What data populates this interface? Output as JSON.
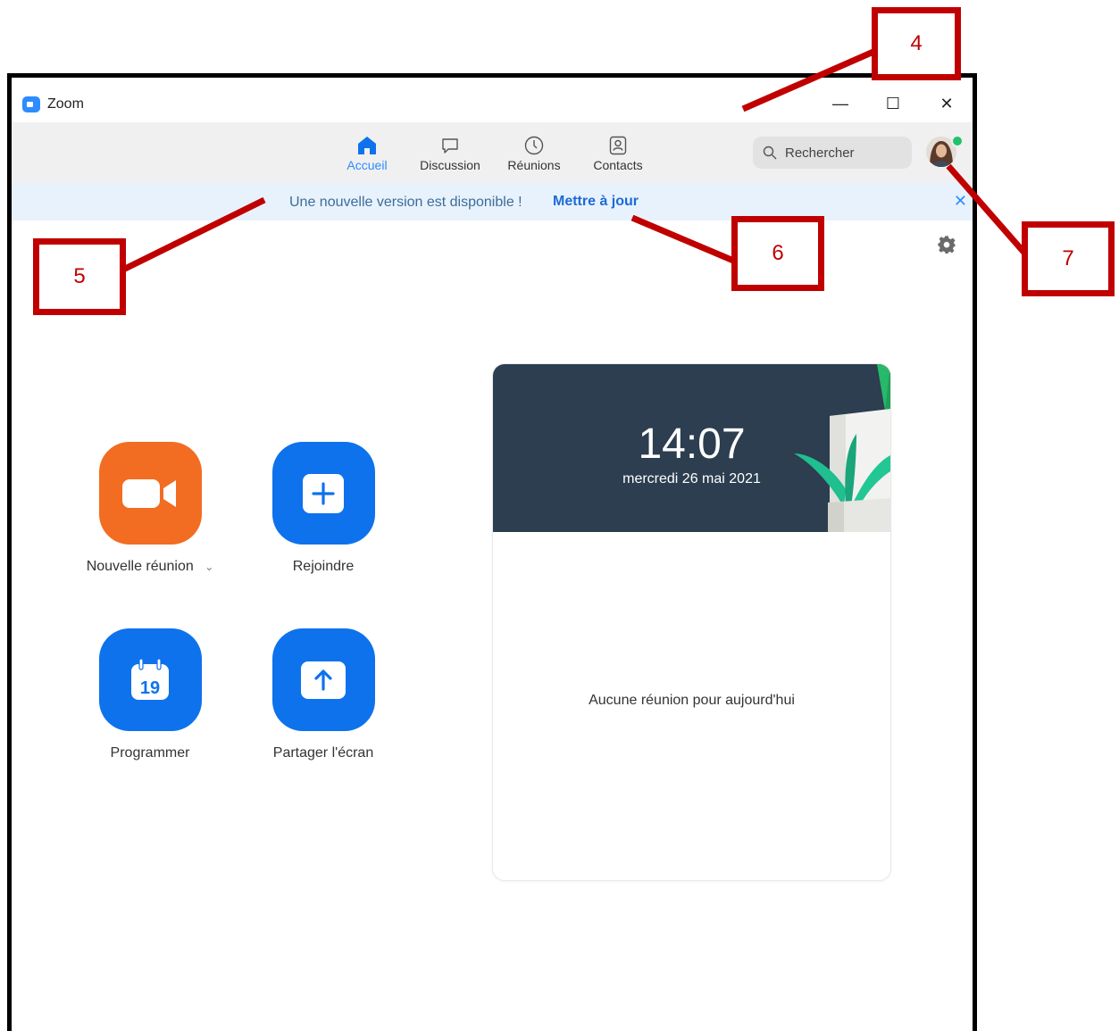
{
  "window": {
    "app_title": "Zoom",
    "controls": {
      "minimize": "—",
      "maximize": "☐",
      "close": "✕"
    }
  },
  "nav": {
    "tabs": [
      {
        "label": "Accueil",
        "icon": "home-icon",
        "active": true
      },
      {
        "label": "Discussion",
        "icon": "chat-icon",
        "active": false
      },
      {
        "label": "Réunions",
        "icon": "clock-icon",
        "active": false
      },
      {
        "label": "Contacts",
        "icon": "contacts-icon",
        "active": false
      }
    ],
    "search_placeholder": "Rechercher",
    "presence_status": "available"
  },
  "banner": {
    "message": "Une nouvelle version est disponible !",
    "action": "Mettre à jour",
    "close": "✕"
  },
  "actions": [
    {
      "label": "Nouvelle réunion",
      "icon": "video-camera-icon",
      "color": "#f26d21",
      "dropdown": "⌄"
    },
    {
      "label": "Rejoindre",
      "icon": "plus-icon",
      "color": "#0e72ed"
    },
    {
      "label": "Programmer",
      "icon": "calendar-icon",
      "color": "#0e72ed",
      "calendar_day": "19"
    },
    {
      "label": "Partager l'écran",
      "icon": "upload-arrow-icon",
      "color": "#0e72ed"
    }
  ],
  "meetings_card": {
    "time": "14:07",
    "date": "mercredi 26 mai 2021",
    "empty_message": "Aucune réunion pour aujourd'hui"
  },
  "callouts": [
    "4",
    "5",
    "6",
    "7"
  ],
  "colors": {
    "accent": "#2d8cff",
    "annotation": "#c00000",
    "header_dark": "#2c3e50"
  }
}
